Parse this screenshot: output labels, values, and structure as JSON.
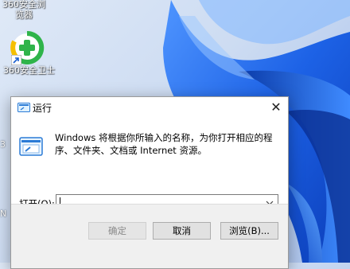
{
  "desktop": {
    "top_icon_label": "360安全浏览器",
    "icon_360_label": "360安全卫士",
    "edge_chars": [
      "3",
      "N"
    ]
  },
  "dialog": {
    "title": "运行",
    "description": "Windows 将根据你所输入的名称，为你打开相应的程序、文件夹、文档或 Internet 资源。",
    "open_label": "打开",
    "open_label_suffix": "(O):",
    "open_label_hotkey": "打开(O):",
    "input_value": "",
    "buttons": {
      "ok": "确定",
      "cancel": "取消",
      "browse": "浏览(B)..."
    },
    "close_glyph": "✕"
  },
  "colors": {
    "wallpaper_blue": "#1565e0",
    "dialog_bg": "#f0f0f0",
    "titlebar_bg": "#ffffff",
    "logo_green": "#2fb44a",
    "logo_yellow": "#f5c000"
  },
  "icons": [
    "360-safe-guard-icon",
    "run-dialog-icon",
    "close-icon",
    "chevron-down-icon",
    "shortcut-arrow-icon"
  ]
}
